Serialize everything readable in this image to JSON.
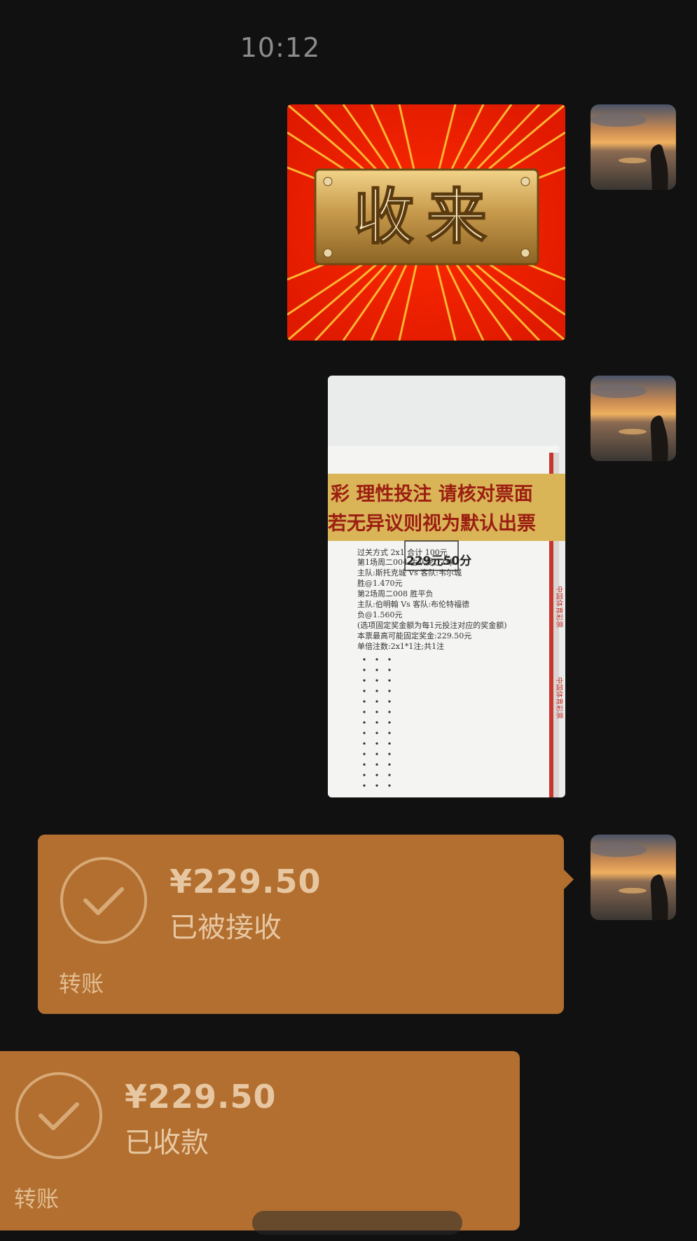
{
  "header": {
    "time": "10:12"
  },
  "messages": {
    "sticker": {
      "caption": "收来"
    },
    "ticket": {
      "banner_line1": "彩  理性投注  请核对票面",
      "banner_line2": "若无异议则视为默认出票",
      "stamp": "229元50分",
      "lines": [
        "过关方式  2x1                              合计  100元",
        "第1场周二004                       主队受让1球",
        "主队:斯托克城 Vs 客队:韦尔城",
        "胜@1.470元",
        "第2场周二008  胜平负",
        "主队:伯明翰 Vs 客队:布伦特福德",
        "负@1.560元",
        "(选项固定奖金额为每1元投注对应的奖金额)",
        "本票最高可能固定奖金:229.50元",
        "单倍注数:2x1*1注;共1注"
      ],
      "side_text": "中国体育彩票"
    },
    "transfer_sent": {
      "amount": "¥229.50",
      "status": "已被接收",
      "label": "转账"
    },
    "transfer_received": {
      "amount": "¥229.50",
      "status": "已收款",
      "label": "转账"
    }
  },
  "colors": {
    "background": "#111111",
    "transfer_bubble": "#b26f2f",
    "transfer_text": "#e7c7a2"
  }
}
